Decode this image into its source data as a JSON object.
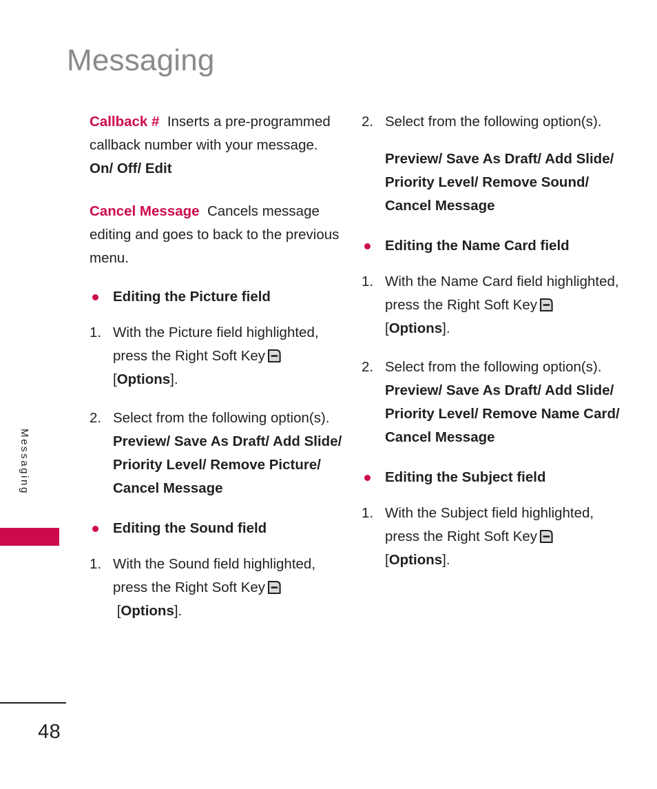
{
  "page": {
    "title": "Messaging",
    "side_tab_label": "Messaging",
    "page_number": "48",
    "accent_color": "#cc0b4e",
    "title_color": "#8a8a8a",
    "text_color": "#231f20"
  },
  "icons": {
    "soft_key": "right-soft-key-icon"
  },
  "left_column": {
    "definitions": [
      {
        "term": "Callback #",
        "description": "Inserts a pre-programmed callback number with your message.",
        "options": "On/ Off/ Edit"
      },
      {
        "term": "Cancel Message",
        "description": "Cancels message editing and goes to back to the previous menu.",
        "options": ""
      }
    ],
    "sections": [
      {
        "heading": "Editing the Picture field",
        "steps": [
          {
            "number": "1.",
            "text_before_icon": "With the Picture field highlighted, press the Right Soft Key",
            "text_after_icon": "[Options].",
            "bracket_open": "[",
            "bracket_label": "Options",
            "bracket_close": "].",
            "options": ""
          },
          {
            "number": "2.",
            "text_before_icon": "Select from the following option(s).",
            "options": "Preview/ Save As Draft/ Add Slide/ Priority Level/ Remove Picture/ Cancel Message"
          }
        ]
      },
      {
        "heading": "Editing the Sound field",
        "steps": [
          {
            "number": "1.",
            "text_before_icon": "With the Sound field highlighted, press the Right Soft Key",
            "bracket_open": "[",
            "bracket_label": "Options",
            "bracket_close": "].",
            "options": ""
          }
        ]
      }
    ]
  },
  "right_column": {
    "sections": [
      {
        "heading": "",
        "steps": [
          {
            "number": "2.",
            "text_before_icon": "Select from the following option(s).",
            "options": "Preview/ Save As Draft/ Add Slide/ Priority Level/ Remove Sound/ Cancel Message"
          }
        ]
      },
      {
        "heading": "Editing the Name Card field",
        "steps": [
          {
            "number": "1.",
            "text_before_icon": "With the Name Card field highlighted, press the Right Soft Key",
            "bracket_open": "[",
            "bracket_label": "Options",
            "bracket_close": "].",
            "options": ""
          },
          {
            "number": "2.",
            "text_before_icon": "Select from the following option(s).",
            "options": "Preview/ Save As Draft/ Add Slide/ Priority Level/ Remove Name Card/ Cancel Message"
          }
        ]
      },
      {
        "heading": "Editing the Subject field",
        "steps": [
          {
            "number": "1.",
            "text_before_icon": "With the Subject field highlighted, press the Right Soft Key",
            "bracket_open": "[",
            "bracket_label": "Options",
            "bracket_close": "].",
            "options": ""
          }
        ]
      }
    ]
  }
}
